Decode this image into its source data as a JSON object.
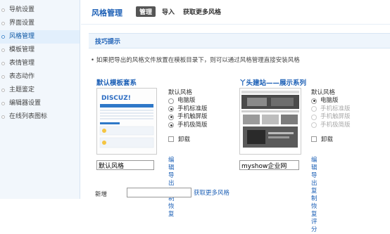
{
  "sidebar": {
    "items": [
      {
        "label": "导航设置",
        "active": false
      },
      {
        "label": "界面设置",
        "active": false
      },
      {
        "label": "风格管理",
        "active": true
      },
      {
        "label": "模板管理",
        "active": false
      },
      {
        "label": "表情管理",
        "active": false
      },
      {
        "label": "表态动作",
        "active": false
      },
      {
        "label": "主题鉴定",
        "active": false
      },
      {
        "label": "编辑器设置",
        "active": false
      },
      {
        "label": "在线列表图标",
        "active": false
      }
    ]
  },
  "header": {
    "title": "风格管理",
    "tabs": [
      {
        "label": "管理",
        "active": true
      },
      {
        "label": "导入",
        "active": false
      },
      {
        "label": "获取更多风格",
        "active": false
      }
    ]
  },
  "tips": {
    "title": "技巧提示",
    "text": "• 如果把导出的风格文件放置在模板目录下，则可以通过风格管理直接安装风格"
  },
  "styles": [
    {
      "name": "默认模板套系",
      "thumb_logo": "DISCUZ!",
      "options_label": "默认风格",
      "options": [
        {
          "label": "电脑版",
          "selected": false,
          "enabled": true
        },
        {
          "label": "手机标准版",
          "selected": true,
          "enabled": true
        },
        {
          "label": "手机触屏版",
          "selected": true,
          "enabled": true
        },
        {
          "label": "手机极简版",
          "selected": true,
          "enabled": true
        }
      ],
      "uninstall_label": "卸载",
      "name_value": "默认风格",
      "links_row1": [
        "编辑",
        "导出"
      ],
      "links_row2": [
        "复制",
        "恢复"
      ]
    },
    {
      "name": "丫头建站——展示系列",
      "options_label": "默认风格",
      "options": [
        {
          "label": "电脑版",
          "selected": true,
          "enabled": true
        },
        {
          "label": "手机标准版",
          "selected": false,
          "enabled": false
        },
        {
          "label": "手机触屏版",
          "selected": false,
          "enabled": false
        },
        {
          "label": "手机极简版",
          "selected": false,
          "enabled": false
        }
      ],
      "uninstall_label": "卸载",
      "name_value": "myshow企业网",
      "links_row1": [
        "编辑",
        "导出"
      ],
      "links_row2": [
        "复制",
        "恢复",
        "评分"
      ]
    }
  ],
  "bottom": {
    "new_label": "新增",
    "more_link": "获取更多风格"
  }
}
